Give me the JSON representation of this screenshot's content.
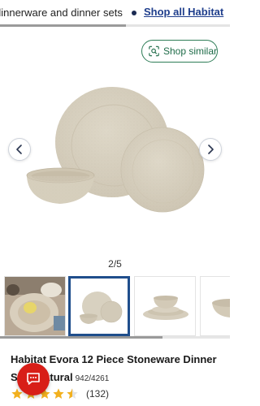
{
  "breadcrumb": {
    "text": "dinnerware and dinner sets",
    "link_label": "Shop all Habitat"
  },
  "gallery": {
    "shop_similar_label": "Shop similar",
    "counter": "2/5",
    "prev_icon": "chevron-left-icon",
    "next_icon": "chevron-right-icon",
    "thumbnails": [
      {
        "name": "lifestyle table setting"
      },
      {
        "name": "dinner set trio"
      },
      {
        "name": "stacked plates and bowl"
      },
      {
        "name": "bowl detail"
      }
    ],
    "active_index": 1
  },
  "product": {
    "title": "Habitat Evora 12 Piece Stoneware Dinner Set - Natural",
    "sku": "942/4261",
    "rating": 4.5,
    "rating_max": 5,
    "review_count": "(132)"
  },
  "colors": {
    "link": "#1f3e8c",
    "accent_green": "#2e7d57",
    "star": "#f2b01e",
    "chat_red": "#d81e18",
    "active_border": "#1f4e8c"
  }
}
